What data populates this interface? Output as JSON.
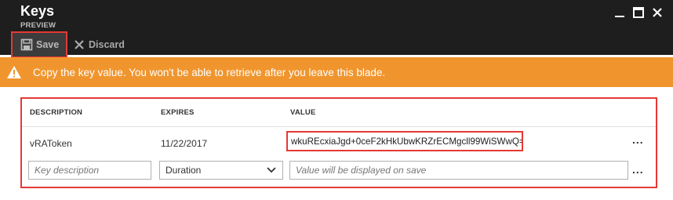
{
  "header": {
    "title": "Keys",
    "subtitle": "PREVIEW"
  },
  "window_controls": {
    "minimize_icon": "minimize-icon",
    "maximize_icon": "maximize-icon",
    "close_icon": "close-icon"
  },
  "toolbar": {
    "save_label": "Save",
    "discard_label": "Discard"
  },
  "banner": {
    "message": "Copy the key value. You won't be able to retrieve after you leave this blade.",
    "color": "#f0952e",
    "icon": "warning-icon"
  },
  "table": {
    "columns": [
      "DESCRIPTION",
      "EXPIRES",
      "VALUE"
    ],
    "rows": [
      {
        "description": "vRAToken",
        "expires": "11/22/2017",
        "value": "wkuREcxiaJgd+0ceF2kHkUbwKRZrECMgcll99WiSWwQ=",
        "more": "..."
      }
    ],
    "new_row": {
      "description_placeholder": "Key description",
      "duration_selected": "Duration",
      "value_placeholder": "Value will be displayed on save",
      "more": "..."
    }
  },
  "colors": {
    "highlight": "#e53935",
    "titlebar": "#1e1e1e"
  }
}
